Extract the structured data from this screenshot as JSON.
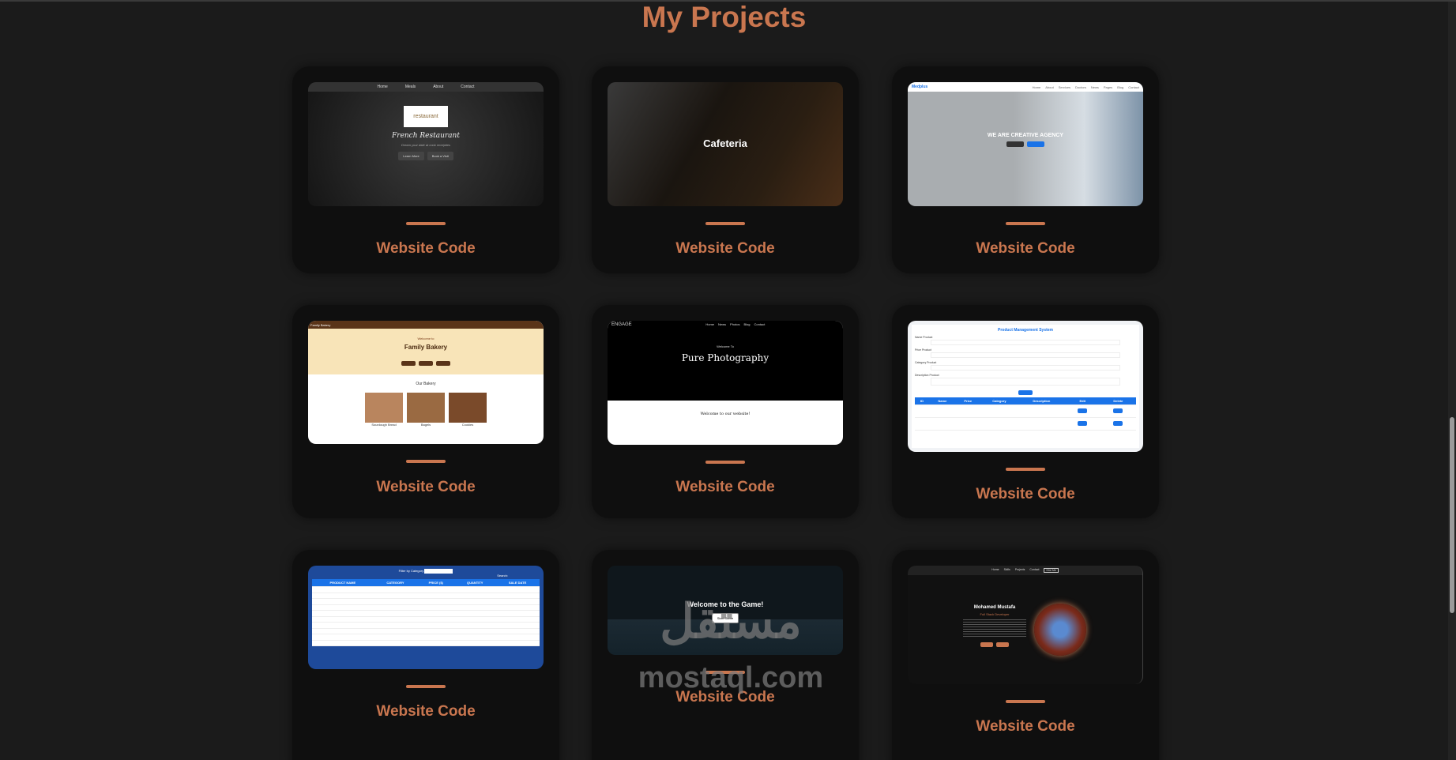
{
  "page_title": "My Projects",
  "projects": [
    {
      "link": "Website Code",
      "preview": {
        "nav": [
          "Home",
          "Meals",
          "About",
          "Contact"
        ],
        "logo": "restaurant",
        "heading": "French Restaurant",
        "sub": "Dream your date at cook receipties",
        "buttons": [
          "Learn More",
          "Book a Visit"
        ]
      }
    },
    {
      "link": "Website Code",
      "preview": {
        "heading": "Cafeteria"
      }
    },
    {
      "link": "Website Code",
      "preview": {
        "brand": "Medplus",
        "nav": [
          "Home",
          "About",
          "Services",
          "Doctors",
          "News",
          "Pages",
          "Blog",
          "Contact"
        ],
        "heading": "WE ARE CREATIVE AGENCY"
      }
    },
    {
      "link": "Website Code",
      "preview": {
        "brand": "Family Bakery",
        "welcome": "Welcome to",
        "heading": "Family Bakery",
        "section": "Our Bakery",
        "items": [
          "Sourdough Bread",
          "Bagels",
          "Cookies"
        ]
      }
    },
    {
      "link": "Website Code",
      "preview": {
        "brand": "ENGAGE",
        "nav": [
          "Home",
          "News",
          "Photos",
          "Blog",
          "Contact"
        ],
        "welcome": "Welcome To",
        "heading": "Pure Photography",
        "section": "Welcome to our website!"
      }
    },
    {
      "link": "Website Code",
      "preview": {
        "heading": "Product Management System",
        "fields": [
          "Name Product",
          "Price Product",
          "Category Product",
          "Description Product"
        ],
        "columns": [
          "ID",
          "Name",
          "Price",
          "Category",
          "Description",
          "Edit",
          "Delete"
        ]
      }
    },
    {
      "link": "Website Code",
      "preview": {
        "filter": "Filter by Category",
        "columns": [
          "PRODUCT NAME",
          "CATEGORY",
          "PRICE ($)",
          "QUANTITY",
          "SALE DATE"
        ],
        "search": "Search:"
      }
    },
    {
      "link": "Website Code",
      "preview": {
        "heading": "Welcome to the Game!",
        "button": "Start Game"
      }
    },
    {
      "link": "Website Code",
      "preview": {
        "nav": [
          "Home",
          "Skills",
          "Projects",
          "Contact",
          "Hire Me"
        ],
        "heading": "Mohamed Mustafa",
        "sub": "Full Stack Developer"
      }
    }
  ],
  "watermark": {
    "arabic": "مستقل",
    "latin": "mostaql.com"
  }
}
